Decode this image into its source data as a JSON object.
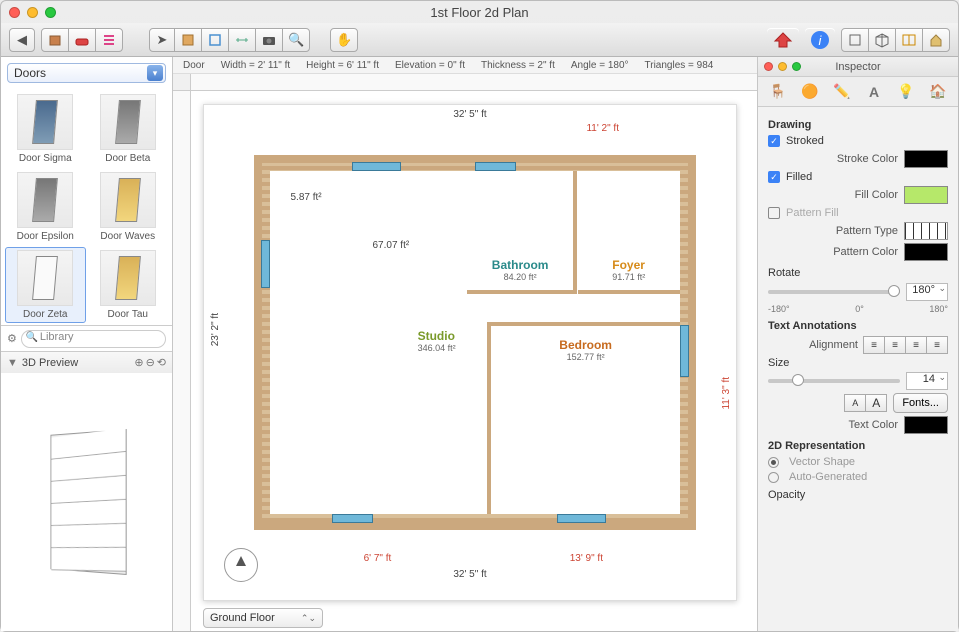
{
  "window": {
    "title": "1st Floor 2d Plan"
  },
  "sidebar": {
    "category": "Doors",
    "items": [
      {
        "label": "Door Sigma",
        "cls": "d-blue"
      },
      {
        "label": "Door Beta",
        "cls": "d-grey"
      },
      {
        "label": "Door Epsilon",
        "cls": "d-grey"
      },
      {
        "label": "Door Waves",
        "cls": "d-yel"
      },
      {
        "label": "Door Zeta",
        "cls": "d-white",
        "selected": true
      },
      {
        "label": "Door Tau",
        "cls": "d-yel"
      }
    ],
    "search_placeholder": "Library",
    "preview_label": "3D Preview"
  },
  "infobar": {
    "object": "Door",
    "width": "Width = 2' 11\" ft",
    "height": "Height = 6' 11\" ft",
    "elevation": "Elevation = 0\" ft",
    "thickness": "Thickness = 2\" ft",
    "angle": "Angle = 180°",
    "triangles": "Triangles = 984"
  },
  "plan": {
    "dims": {
      "top_total": "32' 5\" ft",
      "top_right": "11' 2\" ft",
      "left_total": "23' 2\" ft",
      "right_seg": "11' 3\" ft",
      "bottom_total": "32' 5\" ft",
      "bottom_left": "6' 7\" ft",
      "bottom_right": "13' 9\" ft",
      "studio_note": "5.87 ft²",
      "kitchen_note": "67.07 ft²"
    },
    "rooms": {
      "studio": {
        "name": "Studio",
        "area": "346.04 ft²"
      },
      "bathroom": {
        "name": "Bathroom",
        "area": "84.20 ft²"
      },
      "foyer": {
        "name": "Foyer",
        "area": "91.71 ft²"
      },
      "bedroom": {
        "name": "Bedroom",
        "area": "152.77 ft²"
      }
    },
    "floor_selector": "Ground Floor"
  },
  "inspector": {
    "title": "Inspector",
    "drawing_label": "Drawing",
    "stroked_label": "Stroked",
    "stroke_color_label": "Stroke Color",
    "filled_label": "Filled",
    "fill_color_label": "Fill Color",
    "pattern_fill_label": "Pattern Fill",
    "pattern_type_label": "Pattern Type",
    "pattern_color_label": "Pattern Color",
    "rotate_label": "Rotate",
    "rotate_value": "180°",
    "rotate_ticks": [
      "-180°",
      "0°",
      "180°"
    ],
    "text_label": "Text Annotations",
    "alignment_label": "Alignment",
    "size_label": "Size",
    "size_value": "14",
    "fonts_button": "Fonts...",
    "text_color_label": "Text Color",
    "rep_label": "2D Representation",
    "rep_vector": "Vector Shape",
    "rep_auto": "Auto-Generated",
    "opacity_label": "Opacity",
    "stroked_checked": true,
    "filled_checked": true,
    "pattern_checked": false
  }
}
